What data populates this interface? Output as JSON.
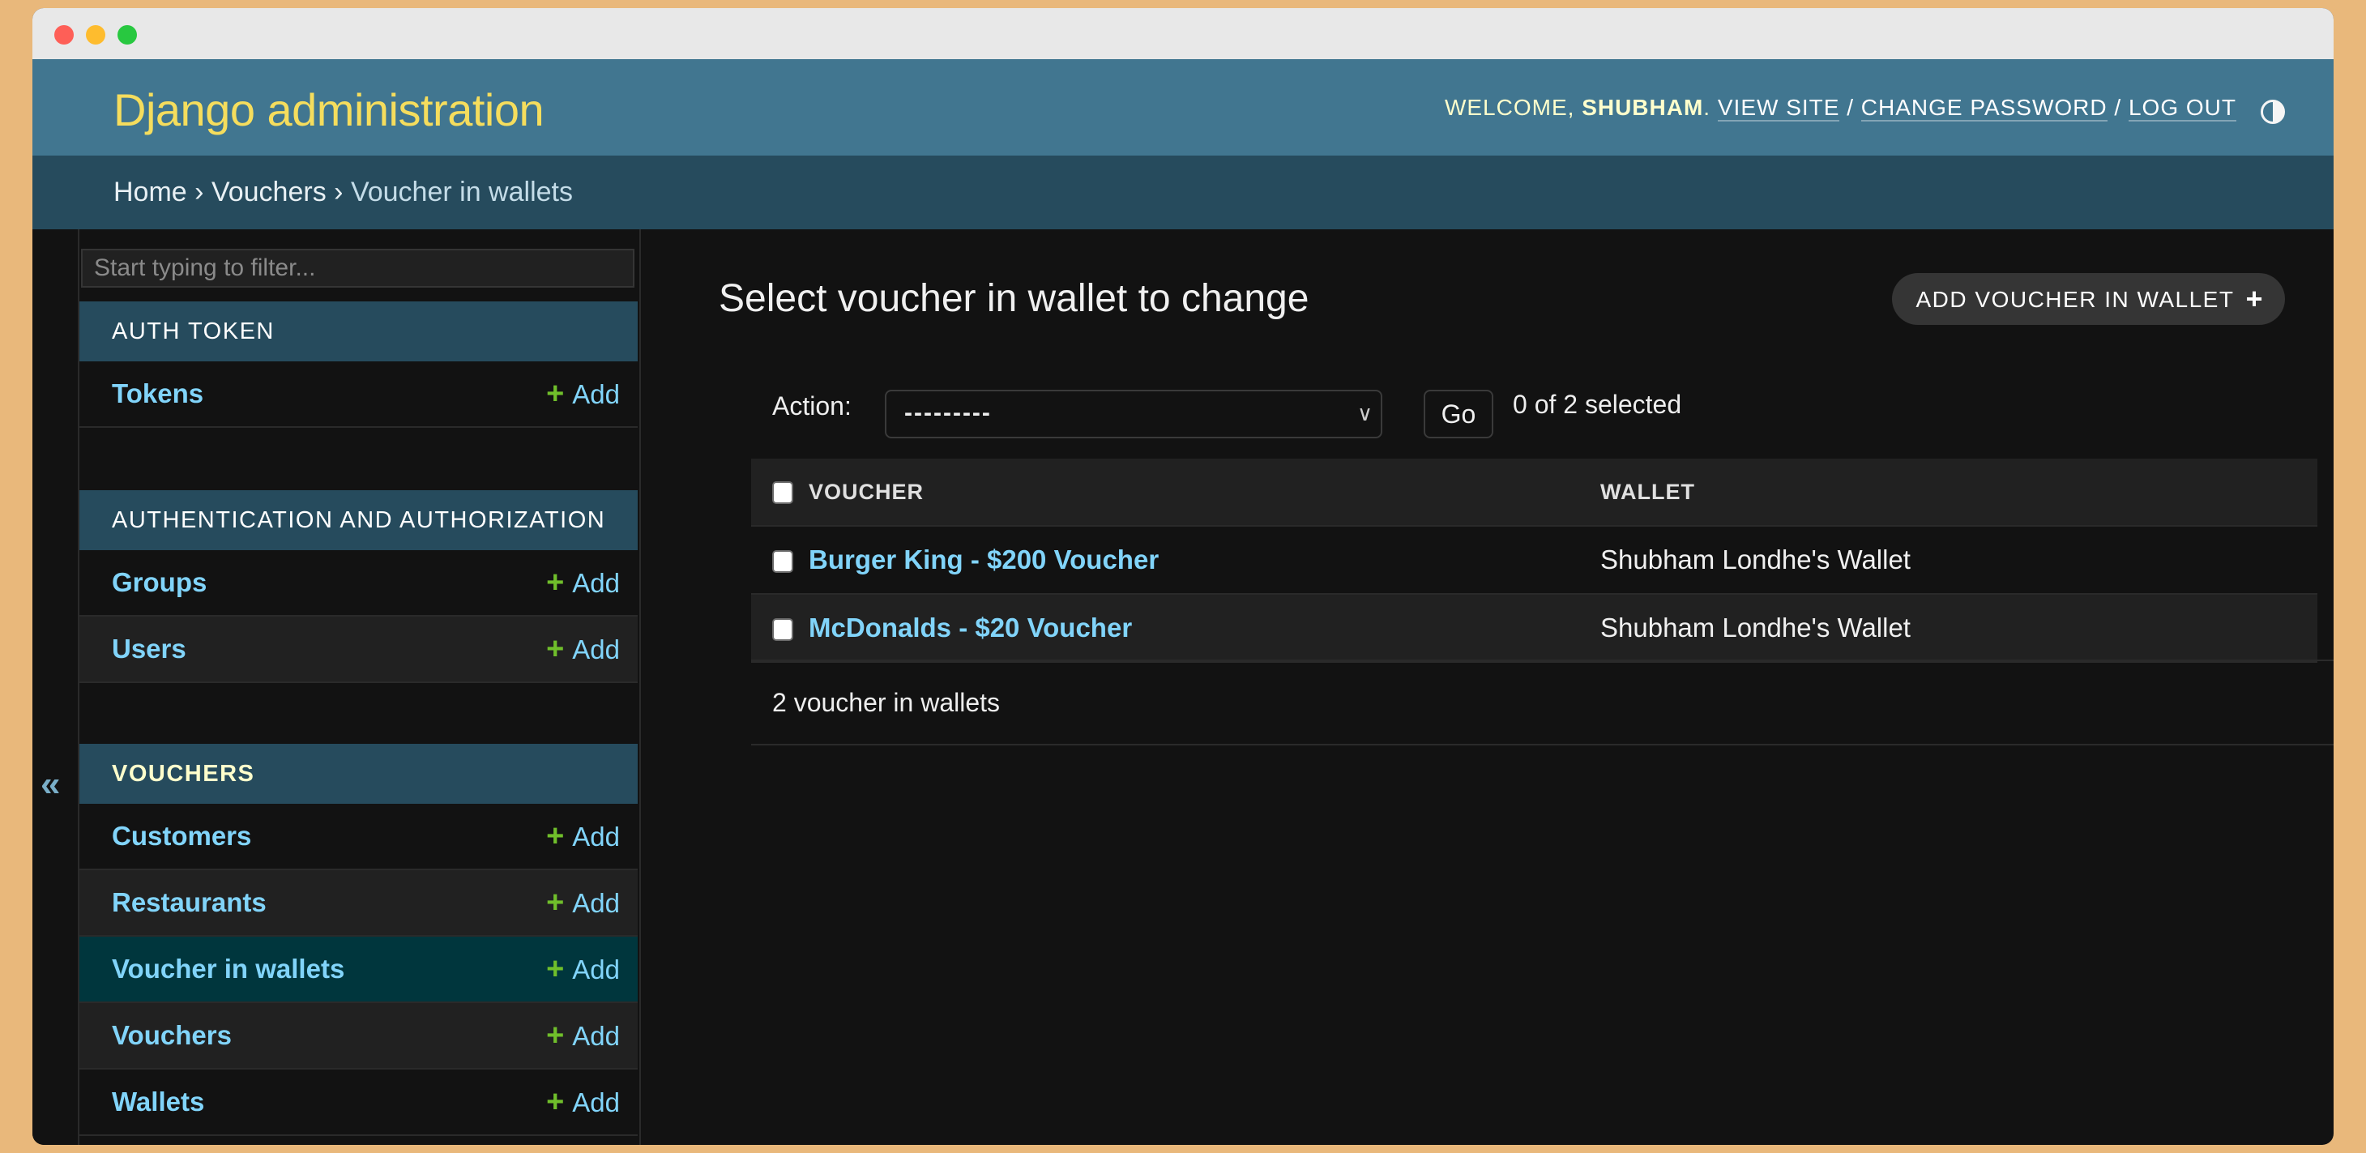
{
  "window": {
    "traffic_lights": [
      "close",
      "minimize",
      "maximize"
    ]
  },
  "header": {
    "brand": "Django administration",
    "welcome": "Welcome,",
    "username": "Shubham",
    "view_site": "View site",
    "change_password": "Change password",
    "log_out": "Log out",
    "separator": "/",
    "theme_toggle_icon": "half-circle-contrast-icon"
  },
  "breadcrumbs": {
    "home": "Home",
    "app": "Vouchers",
    "current": "Voucher in wallets",
    "separator": "›"
  },
  "sidebar": {
    "collapse_icon": "«",
    "filter_placeholder": "Start typing to filter...",
    "modules": [
      {
        "caption": "AUTH TOKEN",
        "models": [
          {
            "name": "Tokens",
            "add": "Add"
          }
        ]
      },
      {
        "caption": "AUTHENTICATION AND AUTHORIZATION",
        "models": [
          {
            "name": "Groups",
            "add": "Add"
          },
          {
            "name": "Users",
            "add": "Add"
          }
        ]
      },
      {
        "caption": "VOUCHERS",
        "current": true,
        "models": [
          {
            "name": "Customers",
            "add": "Add"
          },
          {
            "name": "Restaurants",
            "add": "Add"
          },
          {
            "name": "Voucher in wallets",
            "add": "Add",
            "selected": true
          },
          {
            "name": "Vouchers",
            "add": "Add"
          },
          {
            "name": "Wallets",
            "add": "Add"
          }
        ]
      }
    ],
    "add_icon": "+"
  },
  "main": {
    "title": "Select voucher in wallet to change",
    "add_button": "ADD VOUCHER IN WALLET",
    "add_button_icon": "+",
    "actions": {
      "label": "Action:",
      "selected": "---------",
      "go": "Go",
      "counter": "0 of 2 selected"
    },
    "table": {
      "columns": [
        "VOUCHER",
        "WALLET"
      ],
      "rows": [
        {
          "voucher": "Burger King - $200 Voucher",
          "wallet": "Shubham Londhe's Wallet"
        },
        {
          "voucher": "McDonalds - $20 Voucher",
          "wallet": "Shubham Londhe's Wallet"
        }
      ]
    },
    "paginator": "2 voucher in wallets"
  },
  "colors": {
    "header_bg": "#417690",
    "breadcrumbs_bg": "#264B5D",
    "brand": "#F5DD5D",
    "link": "#81D4FA",
    "add_green": "#70BF2B",
    "selected_row": "#00363D",
    "page_bg": "#121212"
  }
}
